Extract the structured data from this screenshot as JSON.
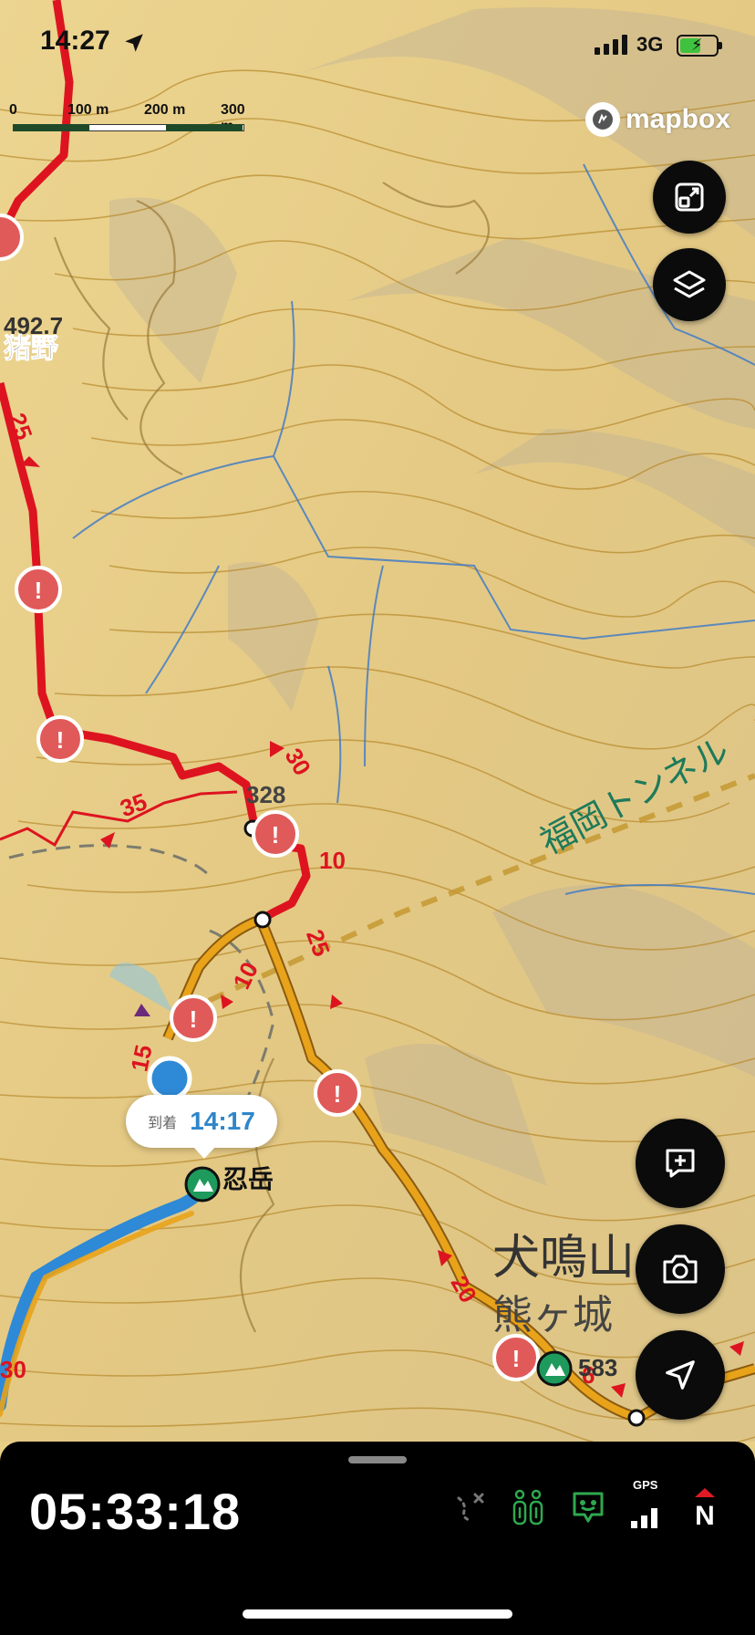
{
  "status_bar": {
    "time": "14:27",
    "network": "3G"
  },
  "scale": {
    "labels": [
      "0",
      "100 m",
      "200 m",
      "300 m"
    ]
  },
  "attribution": {
    "text": "mapbox"
  },
  "map": {
    "place_labels": {
      "inono": "猪野",
      "inonaki_peak": "犬鳴山",
      "kumagajo": "熊ヶ城",
      "oshidake": "忍岳",
      "tunnel": "福岡トンネル"
    },
    "elevation_labels": {
      "e1": "492.7",
      "e2": "328",
      "e3": "583"
    },
    "route_times": {
      "a": "25",
      "b": "35",
      "c": "30",
      "d": "10",
      "e": "10",
      "f": "25",
      "g": "15",
      "h": "20",
      "i": "6",
      "j": "30"
    }
  },
  "arrival": {
    "label": "到着",
    "time": "14:17"
  },
  "bottom_panel": {
    "elapsed_time": "05:33:18",
    "gps_label": "GPS",
    "compass_label": "N"
  },
  "colors": {
    "route_red": "#dd1420",
    "route_orange": "#e8a31a",
    "track_blue": "#2e89d6",
    "peak_green": "#1e9a5c",
    "map_base": "#e8cf86",
    "contour": "#b88a2c",
    "stream": "#3a78c9"
  }
}
